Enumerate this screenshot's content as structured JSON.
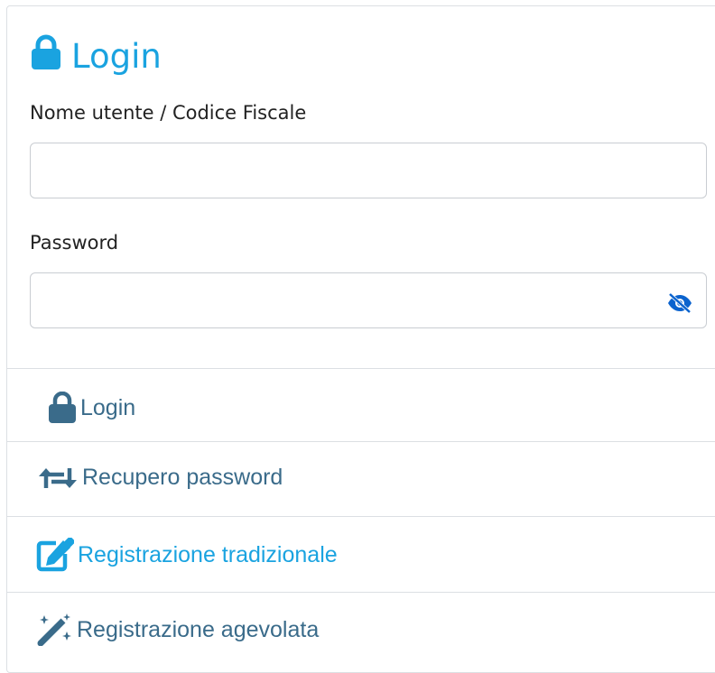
{
  "header": {
    "title": "Login",
    "title_color": "#1aa3e0"
  },
  "form": {
    "username": {
      "label": "Nome utente / Codice Fiscale",
      "value": "",
      "placeholder": ""
    },
    "password": {
      "label": "Password",
      "value": "",
      "placeholder": ""
    }
  },
  "actions": {
    "login": {
      "label": "Login",
      "color": "#3a6b8a",
      "icon": "lock-icon"
    },
    "recover": {
      "label": "Recupero password",
      "color": "#3a6b8a",
      "icon": "retweet-icon"
    },
    "register_traditional": {
      "label": "Registrazione tradizionale",
      "color": "#1aa3e0",
      "icon": "edit-icon"
    },
    "register_easy": {
      "label": "Registrazione agevolata",
      "color": "#3a6b8a",
      "icon": "magic-wand-icon"
    }
  }
}
